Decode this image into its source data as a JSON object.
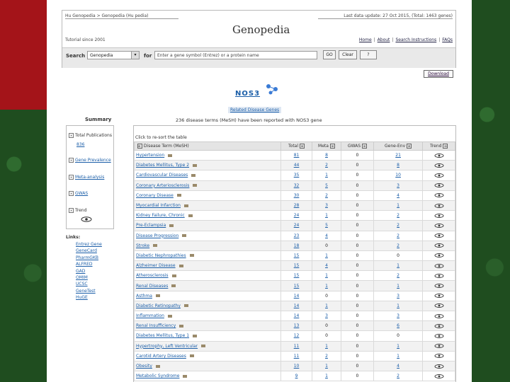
{
  "header": {
    "top_left": "Hu   Genopedia > Genopedia (Hu  pedia)",
    "top_right": "Last data update: 27 Oct 2015, (Total: 1463 genes)",
    "title": "Genopedia",
    "sub_left": "Tutorial   since 2001",
    "nav": [
      "Home",
      "About",
      "Search Instructions",
      "FAQs"
    ]
  },
  "search": {
    "label": "Search",
    "db_value": "Genopedia",
    "for_label": "for",
    "input_placeholder": "Enter a gene symbol (Entrez) or a protein name",
    "go": "GO",
    "clear": "Clear",
    "extra": "?"
  },
  "download": "Download",
  "gene": {
    "symbol": "NOS3"
  },
  "related_genes": "Related Disease Genes",
  "disease_count": "236 disease terms (MeSH) have been reported with NOS3 gene",
  "summary": {
    "title": "Summary",
    "items": [
      {
        "label": "Total Publications",
        "link": "836"
      },
      {
        "label": "Gene Prevalence",
        "link": ""
      },
      {
        "label": "Meta-analysis",
        "link": ""
      },
      {
        "label": "GWAS",
        "link": ""
      },
      {
        "label": "Trend",
        "link": ""
      }
    ]
  },
  "links": {
    "title": "Links:",
    "items": [
      "Entrez Gene",
      "GeneCard",
      "PharmGKB",
      "ALFRED",
      "GAD",
      "OMIM",
      "UCSC",
      "GeneTest",
      "HuGE"
    ]
  },
  "table": {
    "hint": "Click    to re-sort the table",
    "headers": [
      "Disease Term (MeSH)",
      "Total",
      "Meta",
      "GWAS",
      "Gene-Env",
      "Trend"
    ],
    "rows": [
      {
        "term": "Hypertension",
        "total": "81",
        "meta": "8",
        "gwas": "0",
        "env": "21"
      },
      {
        "term": "Diabetes Mellitus, Type 2",
        "total": "44",
        "meta": "2",
        "gwas": "0",
        "env": "8"
      },
      {
        "term": "Cardiovascular Diseases",
        "total": "35",
        "meta": "1",
        "gwas": "0",
        "env": "10"
      },
      {
        "term": "Coronary Arteriosclerosis",
        "total": "32",
        "meta": "5",
        "gwas": "0",
        "env": "3"
      },
      {
        "term": "Coronary Disease",
        "total": "30",
        "meta": "2",
        "gwas": "0",
        "env": "4"
      },
      {
        "term": "Myocardial Infarction",
        "total": "28",
        "meta": "3",
        "gwas": "0",
        "env": "1"
      },
      {
        "term": "Kidney Failure, Chronic",
        "total": "24",
        "meta": "1",
        "gwas": "0",
        "env": "2"
      },
      {
        "term": "Pre-Eclampsia",
        "total": "24",
        "meta": "5",
        "gwas": "0",
        "env": "2"
      },
      {
        "term": "Disease Progression",
        "total": "23",
        "meta": "4",
        "gwas": "0",
        "env": "2"
      },
      {
        "term": "Stroke",
        "total": "18",
        "meta": "0",
        "gwas": "0",
        "env": "2"
      },
      {
        "term": "Diabetic Nephropathies",
        "total": "15",
        "meta": "1",
        "gwas": "0",
        "env": "0"
      },
      {
        "term": "Alzheimer Disease",
        "total": "15",
        "meta": "4",
        "gwas": "0",
        "env": "1"
      },
      {
        "term": "Atherosclerosis",
        "total": "15",
        "meta": "1",
        "gwas": "0",
        "env": "2"
      },
      {
        "term": "Renal Diseases",
        "total": "15",
        "meta": "1",
        "gwas": "0",
        "env": "1"
      },
      {
        "term": "Asthma",
        "total": "14",
        "meta": "0",
        "gwas": "0",
        "env": "3"
      },
      {
        "term": "Diabetic Retinopathy",
        "total": "14",
        "meta": "1",
        "gwas": "0",
        "env": "1"
      },
      {
        "term": "Inflammation",
        "total": "14",
        "meta": "3",
        "gwas": "0",
        "env": "3"
      },
      {
        "term": "Renal Insufficiency",
        "total": "13",
        "meta": "0",
        "gwas": "0",
        "env": "6"
      },
      {
        "term": "Diabetes Mellitus, Type 1",
        "total": "12",
        "meta": "0",
        "gwas": "0",
        "env": "0"
      },
      {
        "term": "Hypertrophy, Left Ventricular",
        "total": "11",
        "meta": "1",
        "gwas": "0",
        "env": "1"
      },
      {
        "term": "Carotid Artery Diseases",
        "total": "11",
        "meta": "2",
        "gwas": "0",
        "env": "1"
      },
      {
        "term": "Obesity",
        "total": "10",
        "meta": "1",
        "gwas": "0",
        "env": "4"
      },
      {
        "term": "Metabolic Syndrome",
        "total": "9",
        "meta": "1",
        "gwas": "0",
        "env": "2"
      }
    ]
  }
}
